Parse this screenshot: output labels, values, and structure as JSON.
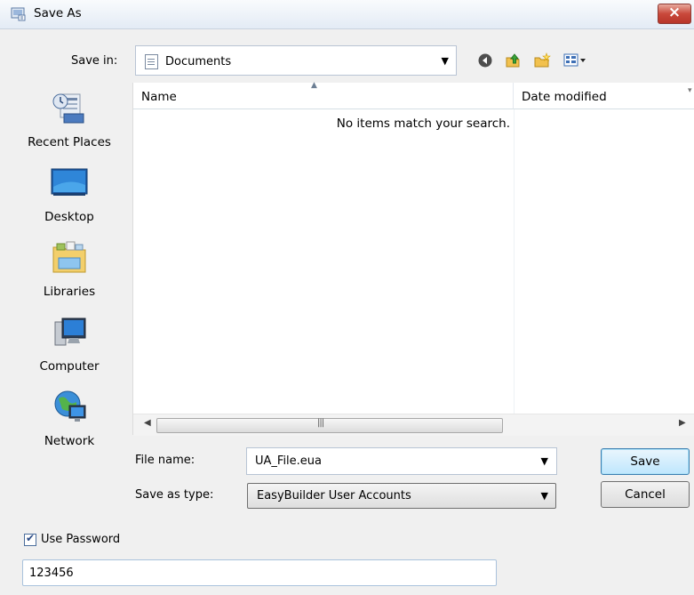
{
  "window": {
    "title": "Save As"
  },
  "toolbar": {
    "save_in_label": "Save in:",
    "save_in_value": "Documents"
  },
  "places": [
    {
      "label": "Recent Places",
      "icon": "recent-places-icon"
    },
    {
      "label": "Desktop",
      "icon": "desktop-icon"
    },
    {
      "label": "Libraries",
      "icon": "libraries-icon"
    },
    {
      "label": "Computer",
      "icon": "computer-icon"
    },
    {
      "label": "Network",
      "icon": "network-icon"
    }
  ],
  "file_list": {
    "columns": [
      "Name",
      "Date modified"
    ],
    "empty_message": "No items match your search."
  },
  "form": {
    "file_name_label": "File name:",
    "file_name_value": "UA_File.eua",
    "save_type_label": "Save as type:",
    "save_type_value": "EasyBuilder User Accounts",
    "save_button": "Save",
    "cancel_button": "Cancel"
  },
  "password": {
    "checkbox_label": "Use Password",
    "checked": true,
    "value": "123456"
  },
  "colors": {
    "title_bar": "#e3ebf5",
    "close_button": "#c9493b",
    "default_button_border": "#3c7fb1"
  }
}
